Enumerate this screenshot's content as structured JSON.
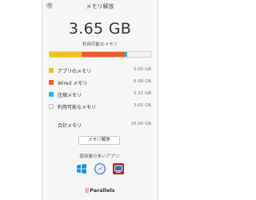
{
  "window": {
    "title": "メモリ解放",
    "close_glyph": "×"
  },
  "summary": {
    "value": "3.65 GB",
    "caption": "利用可能なメモリ"
  },
  "usage_bar": {
    "segments": [
      {
        "key": "app",
        "fraction": 0.32,
        "color": "#f2c21b"
      },
      {
        "key": "wired",
        "fraction": 0.43,
        "color": "#ef5a2a"
      },
      {
        "key": "compressed",
        "fraction": 0.02,
        "color": "#2bb2e6"
      },
      {
        "key": "available",
        "fraction": 0.23,
        "color": "#f4f4f4"
      }
    ]
  },
  "legend": [
    {
      "label": "アプリのメモリ",
      "value": "5.05 GB",
      "color": "#f2c21b"
    },
    {
      "label": "Wired メモリ",
      "value": "6.98 GB",
      "color": "#ef5a2a"
    },
    {
      "label": "圧縮メモリ",
      "value": "0.31 GB",
      "color": "#2bb2e6"
    },
    {
      "label": "利用可能なメモリ",
      "value": "3.65 GB",
      "color": "#ffffff"
    }
  ],
  "total": {
    "label": "合計メモリ",
    "value": "16.00 GB"
  },
  "actions": {
    "free_memory_button": "メモリ解放"
  },
  "apps": {
    "caption": "使用量の多いアプリ:",
    "icons": [
      "windows-icon",
      "safari-icon",
      "parallels-desktop-icon"
    ]
  },
  "brand": {
    "bars": "||",
    "name": "Parallels"
  }
}
